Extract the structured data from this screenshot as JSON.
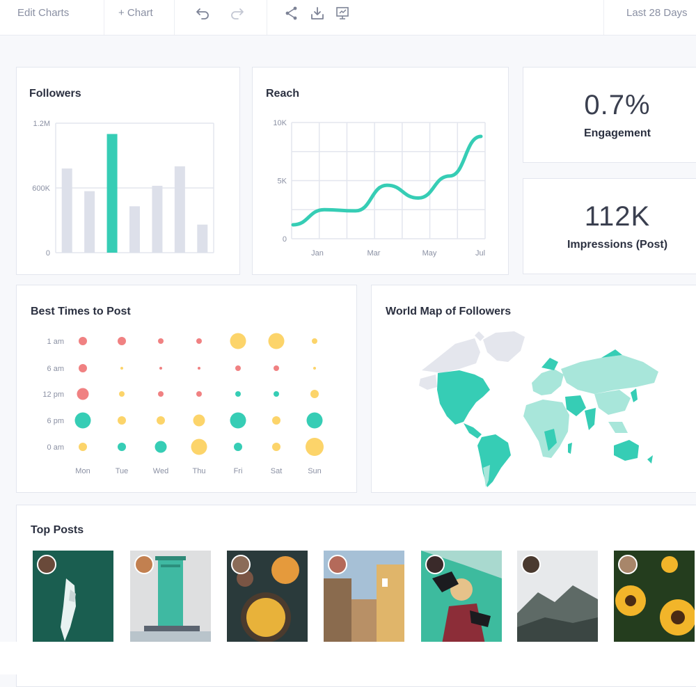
{
  "toolbar": {
    "edit_charts": "Edit Charts",
    "add_chart": "+ Chart",
    "date_range": "Last 28 Days",
    "icons": [
      "undo-icon",
      "redo-icon",
      "share-icon",
      "download-icon",
      "present-icon"
    ]
  },
  "colors": {
    "teal": "#36cdb5",
    "gray_bar": "#dde0ea",
    "red": "#f08182",
    "yellow": "#fcd46a"
  },
  "followers": {
    "title": "Followers",
    "chart_data": {
      "type": "bar",
      "yticks": [
        "1.2M",
        "600K",
        "0"
      ],
      "values": [
        780000,
        570000,
        1100000,
        430000,
        620000,
        800000,
        260000
      ],
      "highlight_index": 2,
      "ylim": [
        0,
        1200000
      ]
    }
  },
  "reach": {
    "title": "Reach",
    "chart_data": {
      "type": "line",
      "yticks": [
        "10K",
        "5K",
        "0"
      ],
      "xticks": [
        "Jan",
        "Mar",
        "May",
        "Jul"
      ],
      "x": [
        0,
        1,
        2,
        3,
        4,
        5,
        6
      ],
      "values": [
        1200,
        2500,
        2400,
        4600,
        3500,
        5400,
        8800
      ],
      "ylim": [
        0,
        10000
      ]
    }
  },
  "engagement": {
    "value": "0.7%",
    "label": "Engagement"
  },
  "impressions": {
    "value": "112K",
    "label": "Impressions (Post)"
  },
  "best_times": {
    "title": "Best Times to Post",
    "chart_data": {
      "type": "scatter",
      "rows": [
        "1 am",
        "6 am",
        "12 pm",
        "6 pm",
        "0 am"
      ],
      "cols": [
        "Mon",
        "Tue",
        "Wed",
        "Thu",
        "Fri",
        "Sat",
        "Sun"
      ],
      "sizes": [
        [
          2,
          2,
          1,
          1,
          4,
          4,
          1
        ],
        [
          2,
          0,
          0,
          0,
          1,
          1,
          0
        ],
        [
          3,
          1,
          1,
          1,
          1,
          1,
          2
        ],
        [
          4,
          2,
          2,
          3,
          4,
          2,
          4
        ],
        [
          2,
          2,
          3,
          4,
          2,
          2,
          5
        ]
      ],
      "colors": [
        [
          "red",
          "red",
          "red",
          "red",
          "yellow",
          "yellow",
          "yellow"
        ],
        [
          "red",
          "yellow",
          "red",
          "red",
          "red",
          "red",
          "yellow"
        ],
        [
          "red",
          "yellow",
          "red",
          "red",
          "teal",
          "teal",
          "yellow"
        ],
        [
          "teal",
          "yellow",
          "yellow",
          "yellow",
          "teal",
          "yellow",
          "teal"
        ],
        [
          "yellow",
          "teal",
          "teal",
          "yellow",
          "teal",
          "yellow",
          "yellow"
        ]
      ]
    }
  },
  "world_map": {
    "title": "World Map of Followers"
  },
  "top_posts": {
    "title": "Top Posts",
    "posts": [
      "post-jetski",
      "post-lighthouse",
      "post-soup",
      "post-street",
      "post-portrait",
      "post-mountains",
      "post-sunflowers"
    ]
  }
}
